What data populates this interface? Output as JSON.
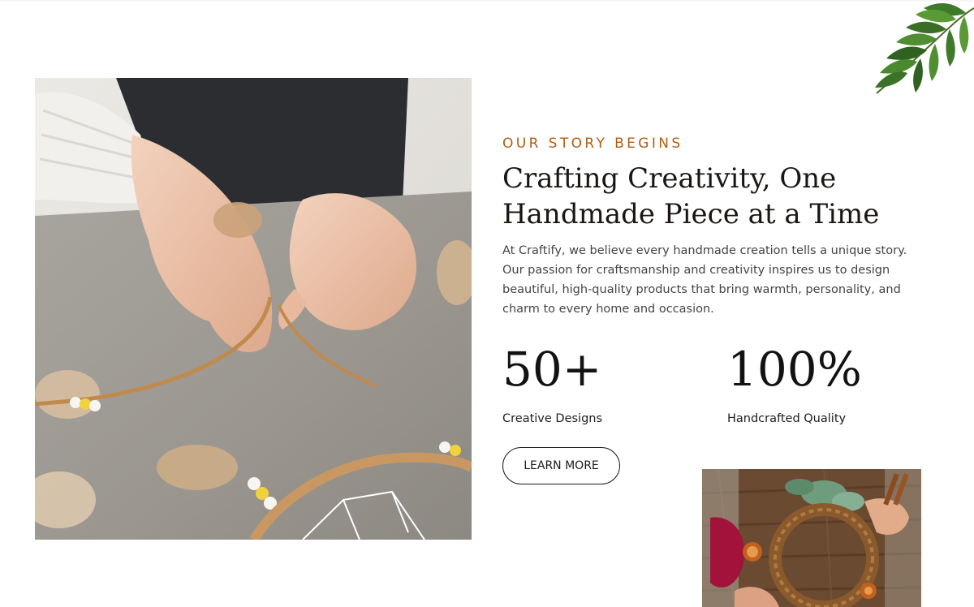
{
  "about": {
    "eyebrow": "OUR STORY BEGINS",
    "headline": "Crafting Creativity, One Handmade Piece at a Time",
    "description": "At Craftify, we believe every handmade creation tells a unique story. Our passion for craftsmanship and creativity inspires us to design beautiful, high-quality products that bring warmth, personality, and charm to every home and occasion.",
    "stats": [
      {
        "value": "50+",
        "label": "Creative Designs"
      },
      {
        "value": "100%",
        "label": "Handcrafted Quality"
      }
    ],
    "cta_label": "LEARN MORE"
  },
  "images": {
    "main_photo": "hands-making-dreamcatcher-photo",
    "secondary_photo": "hands-crafting-wreath-photo",
    "decoration": "leaf-branch-decoration"
  },
  "colors": {
    "accent": "#b35d12",
    "heading": "#1a1613",
    "body_text": "#444444",
    "background": "#ffffff"
  }
}
